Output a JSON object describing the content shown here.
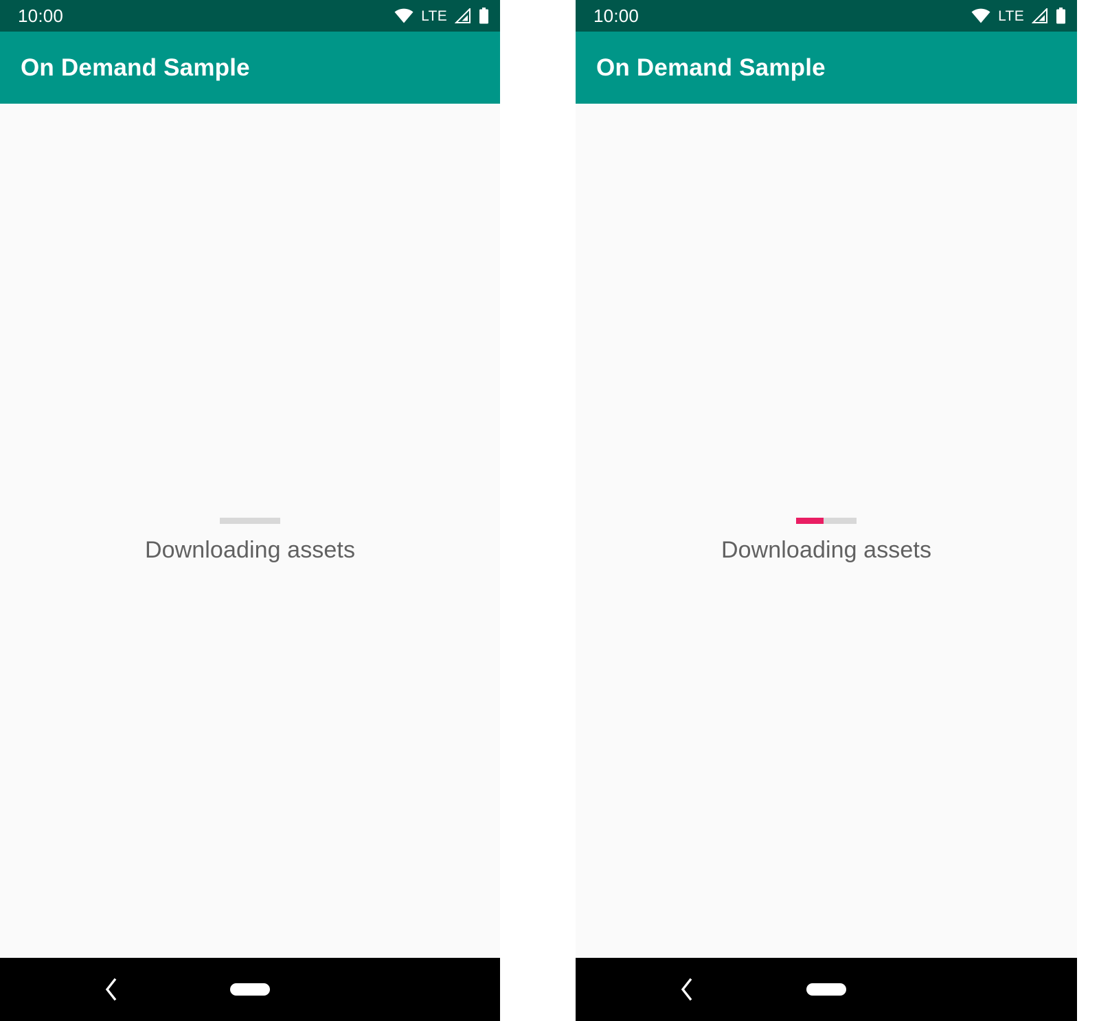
{
  "app": {
    "title": "On Demand Sample",
    "app_bar_color": "#009688",
    "status_bar_color": "#00574B",
    "background_color": "#fafafa"
  },
  "status_bar": {
    "clock": "10:00",
    "network_label": "LTE",
    "icons": [
      "wifi-icon",
      "cellular-signal-icon",
      "battery-icon"
    ]
  },
  "screens": [
    {
      "name": "download-start",
      "status_text": "Downloading assets",
      "progress": {
        "percent": 0,
        "percent_label": "0%",
        "track_color": "#d8d8d8",
        "fill_color": "#E91E63"
      }
    },
    {
      "name": "download-in-progress",
      "status_text": "Downloading assets",
      "progress": {
        "percent": 45,
        "percent_label": "45%",
        "track_color": "#d8d8d8",
        "fill_color": "#E91E63"
      }
    }
  ],
  "nav_bar": {
    "back_label": "Back",
    "home_label": "Home",
    "background_color": "#000000"
  }
}
